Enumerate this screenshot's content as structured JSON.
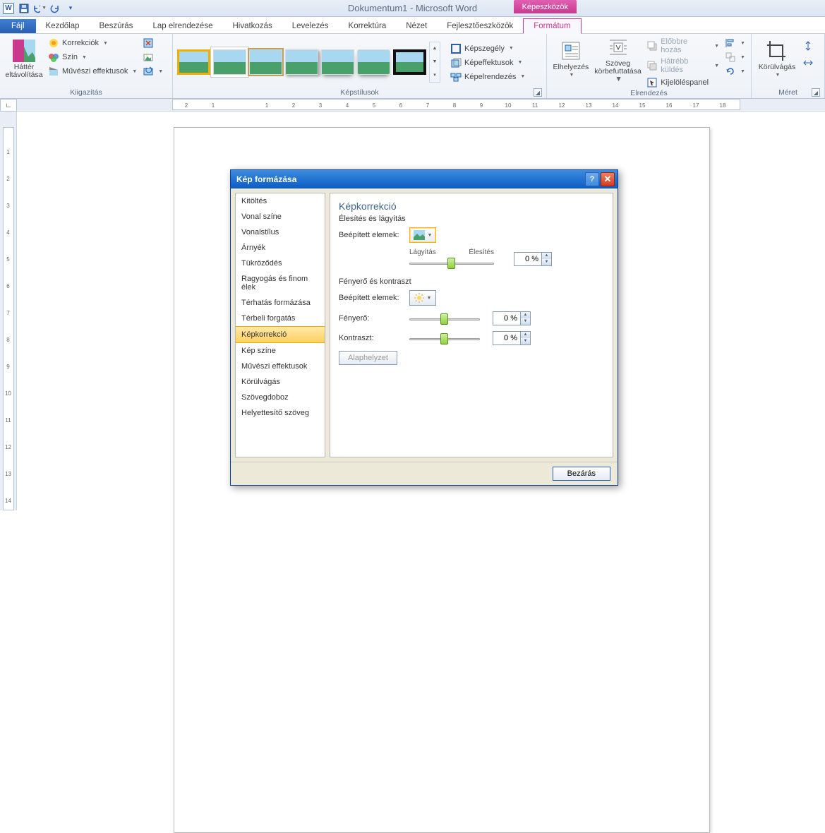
{
  "app_title": "Dokumentum1 - Microsoft Word",
  "context_tab": "Képeszközök",
  "tabs": {
    "file": "Fájl",
    "home": "Kezdőlap",
    "insert": "Beszúrás",
    "layout": "Lap elrendezése",
    "references": "Hivatkozás",
    "mailings": "Levelezés",
    "review": "Korrektúra",
    "view": "Nézet",
    "developer": "Fejlesztőeszközök",
    "format": "Formátum"
  },
  "ribbon": {
    "remove_bg_l1": "Háttér",
    "remove_bg_l2": "eltávolítása",
    "corrections": "Korrekciók",
    "color": "Szín",
    "artistic": "Művészi effektusok",
    "adjust_label": "Kiigazítás",
    "styles_label": "Képstílusok",
    "border": "Képszegély",
    "effects": "Képeffektusok",
    "picture_layout": "Képelrendezés",
    "position_l1": "Elhelyezés",
    "wrap_l1": "Szöveg",
    "wrap_l2": "körbefuttatása",
    "bring_fwd": "Előbbre hozás",
    "send_back": "Hátrébb küldés",
    "selection_pane": "Kijelöléspanel",
    "arrange_label": "Elrendezés",
    "crop": "Körülvágás",
    "size_label": "Méret"
  },
  "dialog": {
    "title": "Kép formázása",
    "nav": [
      "Kitöltés",
      "Vonal színe",
      "Vonalstílus",
      "Árnyék",
      "Tükröződés",
      "Ragyogás és finom élek",
      "Térhatás formázása",
      "Térbeli forgatás",
      "Képkorrekció",
      "Kép színe",
      "Művészi effektusok",
      "Körülvágás",
      "Szövegdoboz",
      "Helyettesítő szöveg"
    ],
    "nav_selected": 8,
    "heading": "Képkorrekció",
    "section1": "Élesítés és lágyítás",
    "presets": "Beépített elemek:",
    "soft": "Lágyítás",
    "sharp": "Élesítés",
    "softsharp_val": "0 %",
    "section2": "Fényerő és kontraszt",
    "brightness": "Fényerő:",
    "brightness_val": "0 %",
    "contrast": "Kontraszt:",
    "contrast_val": "0 %",
    "reset": "Alaphelyzet",
    "close": "Bezárás"
  },
  "ruler_marks": [
    "2",
    "1",
    "",
    "1",
    "2",
    "3",
    "4",
    "5",
    "6",
    "7",
    "8",
    "9",
    "10",
    "11",
    "12",
    "13",
    "14",
    "15",
    "16",
    "17",
    "18"
  ]
}
